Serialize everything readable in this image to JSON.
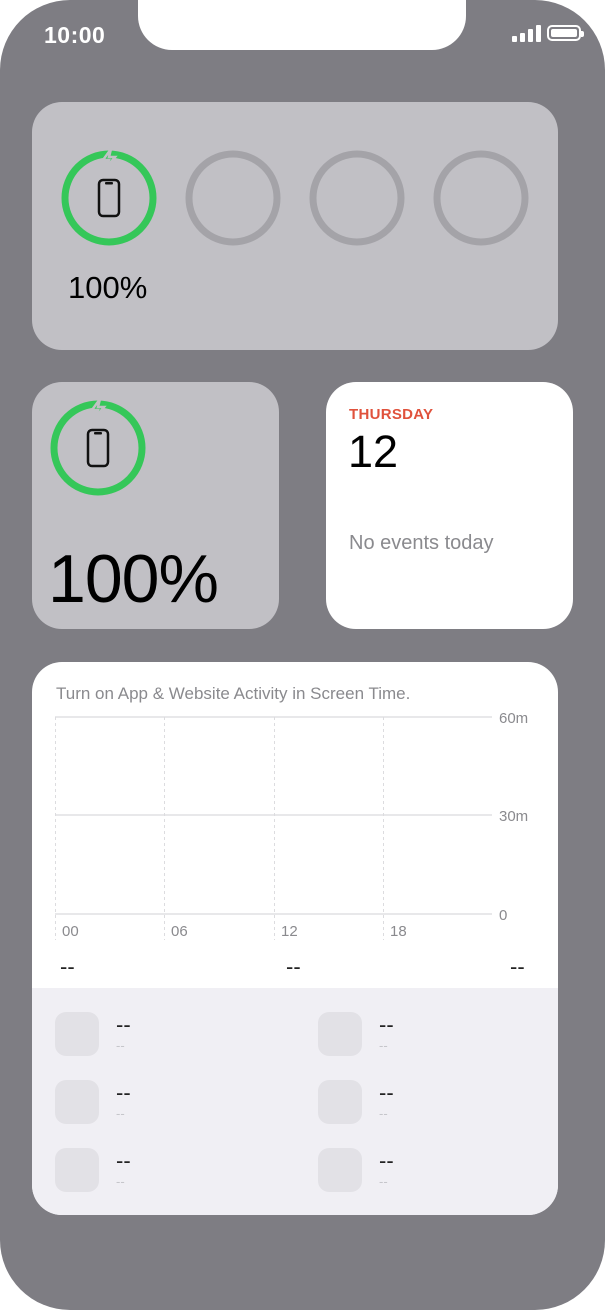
{
  "status_bar": {
    "time": "10:00"
  },
  "battery_large": {
    "percentage": "100%",
    "device_icon": "phone-icon",
    "charging_icon": "bolt-icon",
    "ring_color": "#35c759",
    "empty_slots": 3
  },
  "battery_small": {
    "percentage": "100%",
    "device_icon": "phone-icon",
    "charging_icon": "bolt-icon",
    "ring_color": "#35c759"
  },
  "calendar": {
    "day": "THURSDAY",
    "date": "12",
    "empty_text": "No events today",
    "accent_color": "#e0523c"
  },
  "screen_time": {
    "message": "Turn on App & Website Activity in Screen Time.",
    "y_labels": [
      "60m",
      "30m",
      "0"
    ],
    "x_labels": [
      "00",
      "06",
      "12",
      "18"
    ],
    "totals": [
      "--",
      "--",
      "--"
    ],
    "apps": [
      {
        "name": "--",
        "time": "--"
      },
      {
        "name": "--",
        "time": "--"
      },
      {
        "name": "--",
        "time": "--"
      },
      {
        "name": "--",
        "time": "--"
      },
      {
        "name": "--",
        "time": "--"
      },
      {
        "name": "--",
        "time": "--"
      }
    ]
  }
}
